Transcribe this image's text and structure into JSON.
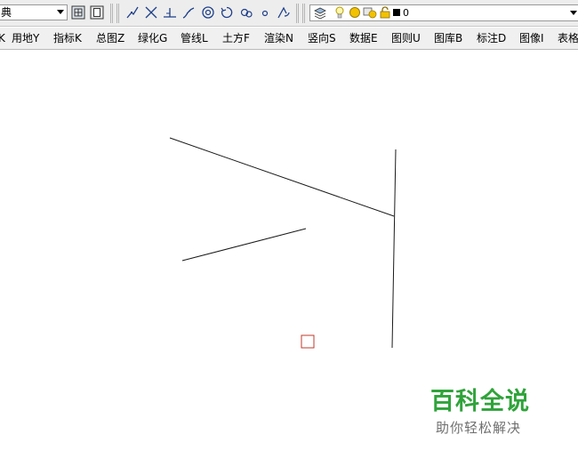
{
  "toolbar": {
    "style_value": "典",
    "layer_value": "0",
    "icons": [
      "zoom-extents-icon",
      "regen-icon",
      "polyline-icon",
      "trim-icon",
      "perpendicular-icon",
      "fillet-icon",
      "circle-icon",
      "rotate-icon",
      "offset-icon",
      "point-icon",
      "arc-tool-icon",
      "layer-manager-icon",
      "bulb-icon",
      "sun-icon",
      "freeze-icon",
      "lock-icon",
      "color-swatch-icon"
    ],
    "accent_color": "#f2c200",
    "swatch_color": "#000000"
  },
  "menubar": {
    "items": [
      "K",
      "用地Y",
      "指标K",
      "总图Z",
      "绿化G",
      "管线L",
      "土方F",
      "渲染N",
      "竖向S",
      "数据E",
      "图则U",
      "图库B",
      "标注D",
      "图像I",
      "表格"
    ]
  },
  "canvas": {
    "stroke_color": "#1a1a1a",
    "marker_color": "#c0392b"
  },
  "watermark": {
    "title": "百科全说",
    "subtitle": "助你轻松解决",
    "color": "#2fa33a"
  }
}
